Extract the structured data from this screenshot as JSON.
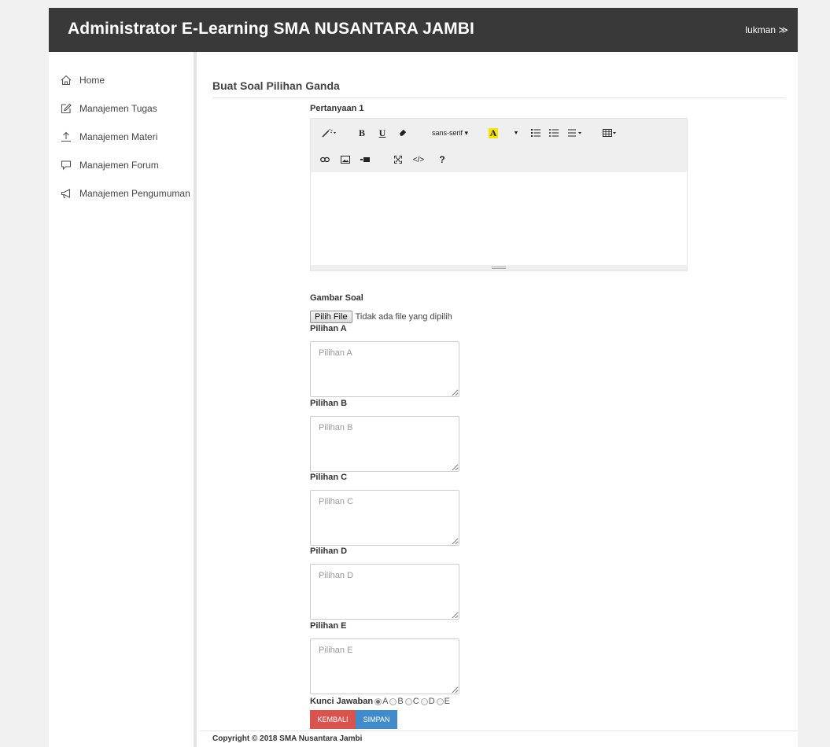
{
  "header": {
    "title": "Administrator E-Learning SMA NUSANTARA JAMBI",
    "user": "lukman ≫"
  },
  "sidebar": {
    "items": [
      {
        "label": "Home",
        "icon": "home-icon"
      },
      {
        "label": "Manajemen Tugas",
        "icon": "edit-icon"
      },
      {
        "label": "Manajemen Materi",
        "icon": "upload-icon"
      },
      {
        "label": "Manajemen Forum",
        "icon": "chat-icon"
      },
      {
        "label": "Manajemen Pengumuman",
        "icon": "megaphone-icon"
      }
    ]
  },
  "main": {
    "title": "Buat Soal Pilihan Ganda",
    "question_label": "Pertanyaan 1",
    "editor": {
      "font_label": "sans-serif ▾",
      "help": "?"
    },
    "image_label": "Gambar Soal",
    "file_button": "Pilih File",
    "file_status": "Tidak ada file yang dipilih",
    "options": [
      {
        "label": "Pilihan A",
        "placeholder": "Pilihan A"
      },
      {
        "label": "Pilihan B",
        "placeholder": "Pilihan B"
      },
      {
        "label": "Pilihan C",
        "placeholder": "Pilihan C"
      },
      {
        "label": "Pilihan D",
        "placeholder": "Pilihan D"
      },
      {
        "label": "Pilihan E",
        "placeholder": "Pilihan E"
      }
    ],
    "answer_label": "Kunci Jawaban",
    "answer_options": [
      "A",
      "B",
      "C",
      "D",
      "E"
    ],
    "answer_selected": "A",
    "buttons": {
      "back": "KEMBALI",
      "save": "SIMPAN"
    }
  },
  "footer": {
    "text": "Copyright © 2018 SMA Nusantara Jambi"
  },
  "colors": {
    "topbar": "#393939",
    "back_button": "#d9534f",
    "save_button": "#428bca",
    "highlight": "#f5e400"
  }
}
